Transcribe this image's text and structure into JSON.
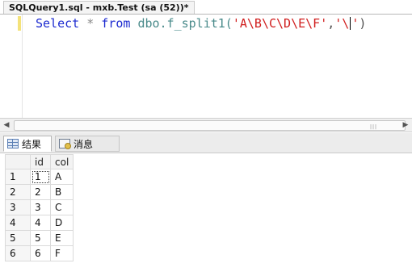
{
  "window": {
    "tab_title": "SQLQuery1.sql - mxb.Test (sa (52))*"
  },
  "editor": {
    "tokens": {
      "select": "Select",
      "star": "*",
      "from": "from",
      "func": "dbo.f_split1(",
      "arg1": "'A\\B\\C\\D\\E\\F'",
      "comma": ",",
      "arg2_open": "'\\",
      "arg2_close": "'",
      "close_paren": ")"
    }
  },
  "results": {
    "tabs": [
      {
        "label": "结果",
        "icon": "grid-icon"
      },
      {
        "label": "消息",
        "icon": "message-icon"
      }
    ],
    "columns": [
      "id",
      "col"
    ],
    "rows": [
      {
        "num": "1",
        "id": "1",
        "col": "A"
      },
      {
        "num": "2",
        "id": "2",
        "col": "B"
      },
      {
        "num": "3",
        "id": "3",
        "col": "C"
      },
      {
        "num": "4",
        "id": "4",
        "col": "D"
      },
      {
        "num": "5",
        "id": "5",
        "col": "E"
      },
      {
        "num": "6",
        "id": "6",
        "col": "F"
      }
    ]
  }
}
